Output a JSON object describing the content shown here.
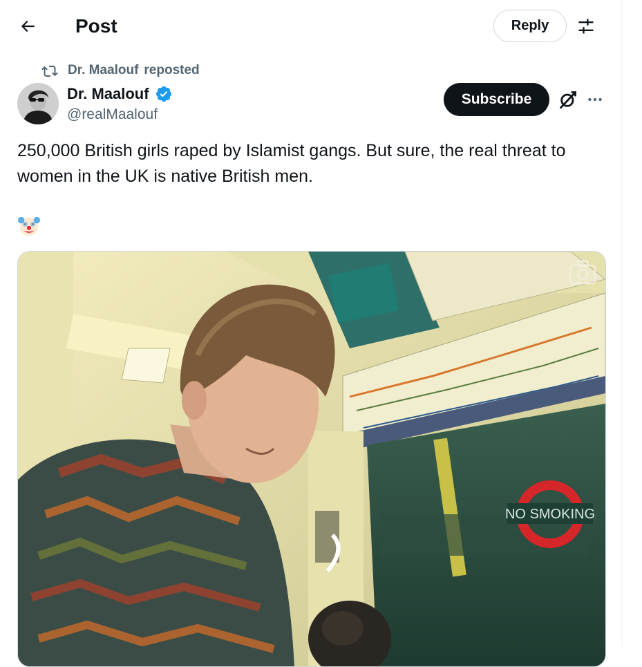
{
  "header": {
    "title": "Post",
    "reply_label": "Reply"
  },
  "repost": {
    "name": "Dr. Maalouf",
    "text": "reposted"
  },
  "author": {
    "name": "Dr. Maalouf",
    "handle": "@realMaalouf",
    "verified_color": "#1d9bf0"
  },
  "actions": {
    "subscribe_label": "Subscribe"
  },
  "post": {
    "text": "250,000 British girls raped by Islamist gangs. But sure, the real threat to women in the UK is native British men.",
    "emoji": "clown-face"
  },
  "media": {
    "sign_text": "NO SMOKING",
    "icons": [
      "camera-icon"
    ]
  },
  "icons": [
    "back-arrow-icon",
    "filter-icon",
    "repost-icon",
    "verified-badge-icon",
    "grok-icon",
    "more-icon"
  ]
}
